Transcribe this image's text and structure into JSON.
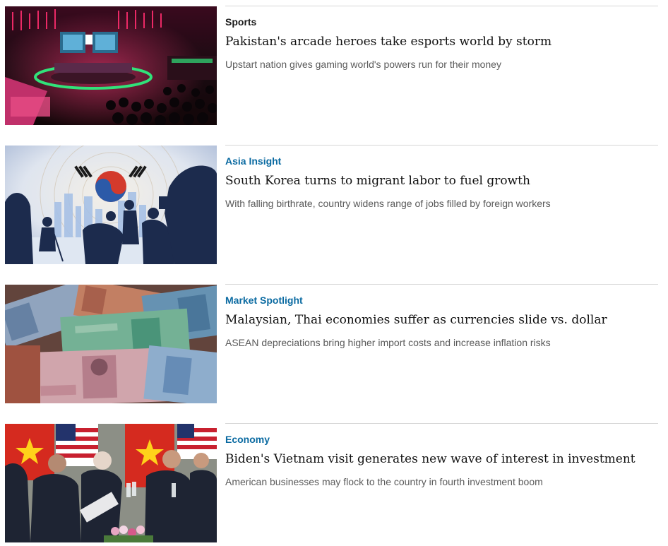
{
  "articles": [
    {
      "category": "Sports",
      "category_color": "#1a1a1a",
      "headline": "Pakistan's arcade heroes take esports world by storm",
      "summary": "Upstart nation gives gaming world's powers run for their money",
      "image_subject": "esports-arena-photo"
    },
    {
      "category": "Asia Insight",
      "category_color": "#0a6aa1",
      "headline": "South Korea turns to migrant labor to fuel growth",
      "summary": "With falling birthrate, country widens range of jobs filled by foreign workers",
      "image_subject": "korean-flag-workers-illustration"
    },
    {
      "category": "Market Spotlight",
      "category_color": "#0a6aa1",
      "headline": "Malaysian, Thai economies suffer as currencies slide vs. dollar",
      "summary": "ASEAN depreciations bring higher import costs and increase inflation risks",
      "image_subject": "banknotes-photo"
    },
    {
      "category": "Economy",
      "category_color": "#0a6aa1",
      "headline": "Biden's Vietnam visit generates new wave of interest in investment",
      "summary": "American businesses may flock to the country in fourth investment boom",
      "image_subject": "state-dinner-toast-photo"
    }
  ]
}
